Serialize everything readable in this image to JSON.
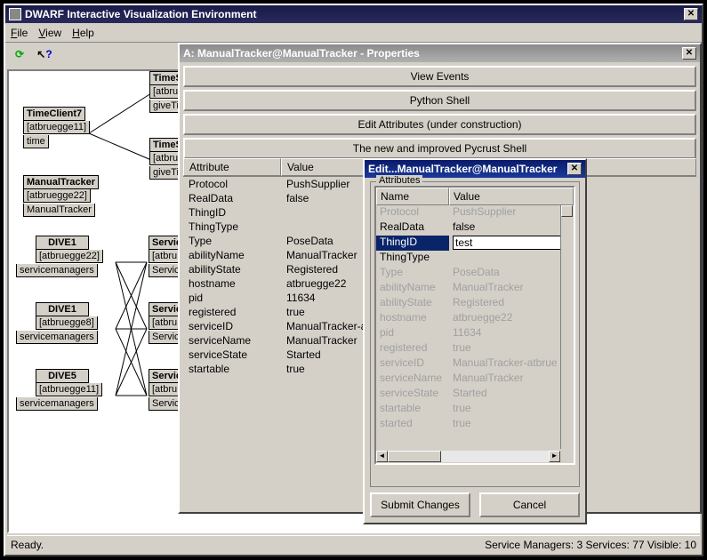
{
  "main": {
    "title": "DWARF Interactive Visualization Environment"
  },
  "menu": {
    "file": "File",
    "view": "View",
    "help": "Help"
  },
  "status": {
    "left": "Ready.",
    "right": "Service Managers: 3 Services: 77 Visible: 10"
  },
  "nodes": {
    "tc7": {
      "name": "TimeClient7",
      "host": "[atbruegge11]",
      "svc": "time"
    },
    "mt": {
      "name": "ManualTracker",
      "host": "[atbruegge22]",
      "svc": "ManualTracker"
    },
    "d1": {
      "name": "DIVE1",
      "host": "[atbruegge22]",
      "svc": "servicemanagers"
    },
    "d1b": {
      "name": "DIVE1",
      "host": "[atbruegge8]",
      "svc": "servicemanagers"
    },
    "d5": {
      "name": "DIVE5",
      "host": "[atbruegge11]",
      "svc": "servicemanagers"
    },
    "ts1": {
      "name": "TimeS",
      "host": "[atbru",
      "svc": "giveTi"
    },
    "ts2": {
      "name": "TimeS",
      "host": "[atbru",
      "svc": "giveTi"
    },
    "svc1": {
      "name": "Servic",
      "host": "[atbru",
      "svc": "Service"
    },
    "svc2": {
      "name": "Servic",
      "host": "[atbru",
      "svc": "Service"
    },
    "svc3": {
      "name": "Servic",
      "host": "[atbru",
      "svc": "Service"
    }
  },
  "prop": {
    "title": "A: ManualTracker@ManualTracker - Properties",
    "tabs": [
      "View Events",
      "Python Shell",
      "Edit Attributes (under construction)",
      "The new and improved Pycrust Shell"
    ],
    "hdr": {
      "c1": "Attribute",
      "c2": "Value"
    },
    "rows": [
      {
        "n": "Protocol",
        "v": "PushSupplier"
      },
      {
        "n": "RealData",
        "v": "false"
      },
      {
        "n": "ThingID",
        "v": ""
      },
      {
        "n": "ThingType",
        "v": ""
      },
      {
        "n": "Type",
        "v": "PoseData"
      },
      {
        "n": "abilityName",
        "v": "ManualTracker"
      },
      {
        "n": "abilityState",
        "v": "Registered"
      },
      {
        "n": "hostname",
        "v": "atbruegge22"
      },
      {
        "n": "pid",
        "v": "11634"
      },
      {
        "n": "registered",
        "v": "true"
      },
      {
        "n": "serviceID",
        "v": "ManualTracker-atb"
      },
      {
        "n": "serviceName",
        "v": "ManualTracker"
      },
      {
        "n": "serviceState",
        "v": "Started"
      },
      {
        "n": "startable",
        "v": "true"
      }
    ]
  },
  "edit": {
    "title": "Edit...ManualTracker@ManualTracker",
    "legend": "Attributes",
    "hdr": {
      "c1": "Name",
      "c2": "Value"
    },
    "input": "test",
    "rows": [
      {
        "n": "Protocol",
        "v": "PushSupplier",
        "d": true
      },
      {
        "n": "RealData",
        "v": "false"
      },
      {
        "n": "ThingID",
        "v": "",
        "sel": true
      },
      {
        "n": "ThingType",
        "v": ""
      },
      {
        "n": "Type",
        "v": "PoseData",
        "d": true
      },
      {
        "n": "abilityName",
        "v": "ManualTracker",
        "d": true
      },
      {
        "n": "abilityState",
        "v": "Registered",
        "d": true
      },
      {
        "n": "hostname",
        "v": "atbruegge22",
        "d": true
      },
      {
        "n": "pid",
        "v": "11634",
        "d": true
      },
      {
        "n": "registered",
        "v": "true",
        "d": true
      },
      {
        "n": "serviceID",
        "v": "ManualTracker-atbrue",
        "d": true
      },
      {
        "n": "serviceName",
        "v": "ManualTracker",
        "d": true
      },
      {
        "n": "serviceState",
        "v": "Started",
        "d": true
      },
      {
        "n": "startable",
        "v": "true",
        "d": true
      },
      {
        "n": "started",
        "v": "true",
        "d": true
      },
      {
        "n": "",
        "v": "",
        "d": true
      }
    ],
    "submit": "Submit Changes",
    "cancel": "Cancel"
  }
}
